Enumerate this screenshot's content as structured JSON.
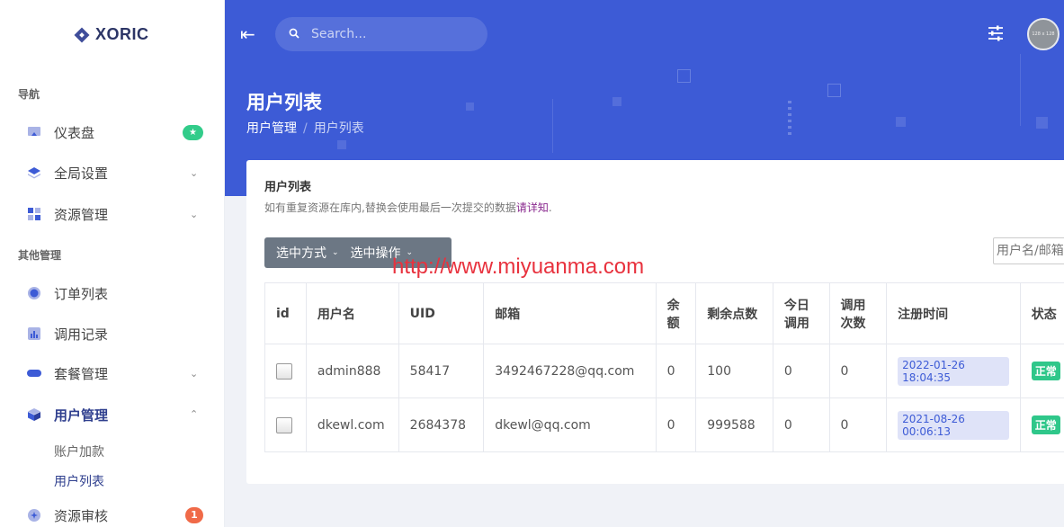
{
  "brand": {
    "name": "XORIC"
  },
  "sidebar": {
    "section_nav": "导航",
    "section_other": "其他管理",
    "items": [
      {
        "label": "仪表盘",
        "badge": "★"
      },
      {
        "label": "全局设置"
      },
      {
        "label": "资源管理"
      },
      {
        "label": "订单列表"
      },
      {
        "label": "调用记录"
      },
      {
        "label": "套餐管理"
      },
      {
        "label": "用户管理"
      },
      {
        "label": "资源审核",
        "badge": "1"
      }
    ],
    "subitems": [
      {
        "label": "账户加款"
      },
      {
        "label": "用户列表"
      }
    ]
  },
  "header": {
    "search_placeholder": "Search...",
    "avatar_text": "128 x 128",
    "page_title": "用户列表",
    "breadcrumb": [
      "用户管理",
      "用户列表"
    ]
  },
  "card": {
    "title": "用户列表",
    "desc": "如有重复资源在库内,替换会使用最后一次提交的数据",
    "desc_link": "请详知",
    "desc_end": ".",
    "btn_select_mode": "选中方式",
    "btn_select_action": "选中操作",
    "filter_placeholder": "用户名/邮箱",
    "watermark": "http://www.miyuanma.com"
  },
  "table": {
    "headers": {
      "id": "id",
      "username": "用户名",
      "uid": "UID",
      "email": "邮箱",
      "balance_1": "余",
      "balance_2": "额",
      "points": "剩余点数",
      "today_1": "今日",
      "today_2": "调用",
      "calls_1": "调用",
      "calls_2": "次数",
      "reg_time": "注册时间",
      "status": "状态"
    },
    "rows": [
      {
        "username": "admin888",
        "uid": "58417",
        "email": "3492467228@qq.com",
        "balance": "0",
        "points": "100",
        "today": "0",
        "calls": "0",
        "reg_time": "2022-01-26 18:04:35",
        "status": "正常"
      },
      {
        "username": "dkewl.com",
        "uid": "2684378",
        "email": "dkewl@qq.com",
        "balance": "0",
        "points": "999588",
        "today": "0",
        "calls": "0",
        "reg_time": "2021-08-26 00:06:13",
        "status": "正常"
      }
    ]
  }
}
